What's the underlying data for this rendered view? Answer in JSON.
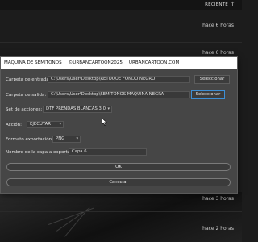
{
  "background_app": {
    "sort_label": "RECIENTE",
    "row_times": [
      "hace 6 horas",
      "hace 6 horas",
      "hace 3 horas",
      "hace 2 horas"
    ]
  },
  "dialog": {
    "title_parts": [
      "MAQUINA DE SEMITONOS",
      "©URBANCARTOON2025",
      "URBANCARTOON.COM"
    ],
    "input_folder": {
      "label": "Carpeta de entrada:",
      "value": "C:\\Users\\User\\Desktop\\RETOQUE FONDO NEGRO",
      "button": "Seleccionar"
    },
    "output_folder": {
      "label": "Carpeta de salida:",
      "value": "C:\\Users\\User\\Desktop\\SEMITONOS MAQUINA NEGRA",
      "button": "Seleccionar"
    },
    "action_set": {
      "label": "Set de acciones:",
      "value": "DTF PRENDAS BLANCAS 3.0"
    },
    "action": {
      "label": "Acción:",
      "value": "EJECUTAR"
    },
    "export_format": {
      "label": "Formato exportación:",
      "value": "PNG"
    },
    "layer_name": {
      "label": "Nombre de la capa a exportar:",
      "value": "Capa 6"
    },
    "ok_label": "OK",
    "cancel_label": "Cancelar"
  },
  "colors": {
    "dialog_bg": "#464646",
    "titlebar_bg": "#ffffff",
    "focus_accent": "#3d8fd6",
    "app_bg": "#1c1c1c"
  }
}
